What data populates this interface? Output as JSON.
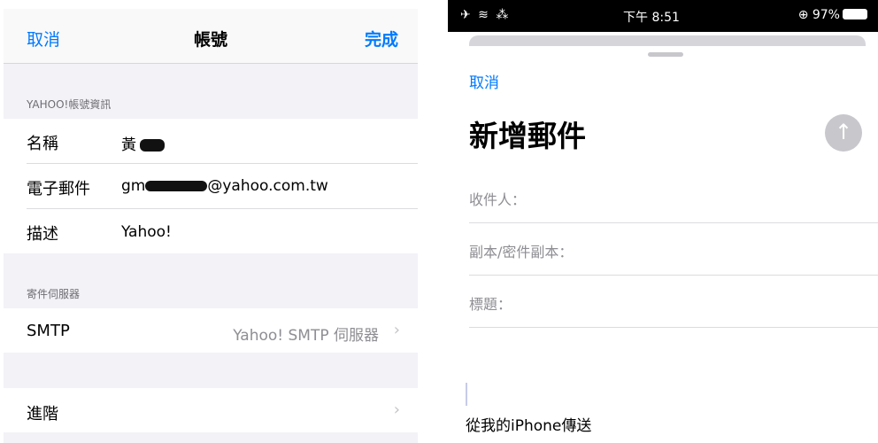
{
  "left": {
    "nav": {
      "cancel": "取消",
      "title": "帳號",
      "done": "完成"
    },
    "account_section": "YAHOO!帳號資訊",
    "rows": [
      {
        "label": "名稱",
        "value_visible": "黃"
      },
      {
        "label": "電子郵件",
        "value_prefix": "gm",
        "value_suffix": "@yahoo.com.tw"
      },
      {
        "label": "描述",
        "value": "Yahoo!"
      }
    ],
    "outgoing_section": "寄件伺服器",
    "smtp": {
      "label": "SMTP",
      "detail": "Yahoo! SMTP 伺服器"
    },
    "advanced": {
      "label": "進階"
    }
  },
  "right": {
    "status": {
      "left": "✈ ≋ ⁂",
      "time": "下午 8:51",
      "battery": "⊕ 97%"
    },
    "compose": {
      "cancel": "取消",
      "title": "新增郵件",
      "fields": [
        "收件人：",
        "副本/密件副本：",
        "標題："
      ],
      "signature": "從我的iPhone傳送"
    }
  },
  "colors": {
    "accent": "#007aff",
    "send_disabled": "#c7c7cc",
    "grouped_bg": "#f2f2f7"
  },
  "icons": {
    "chevron": "chevron-right-icon",
    "send": "arrow-up-icon"
  }
}
